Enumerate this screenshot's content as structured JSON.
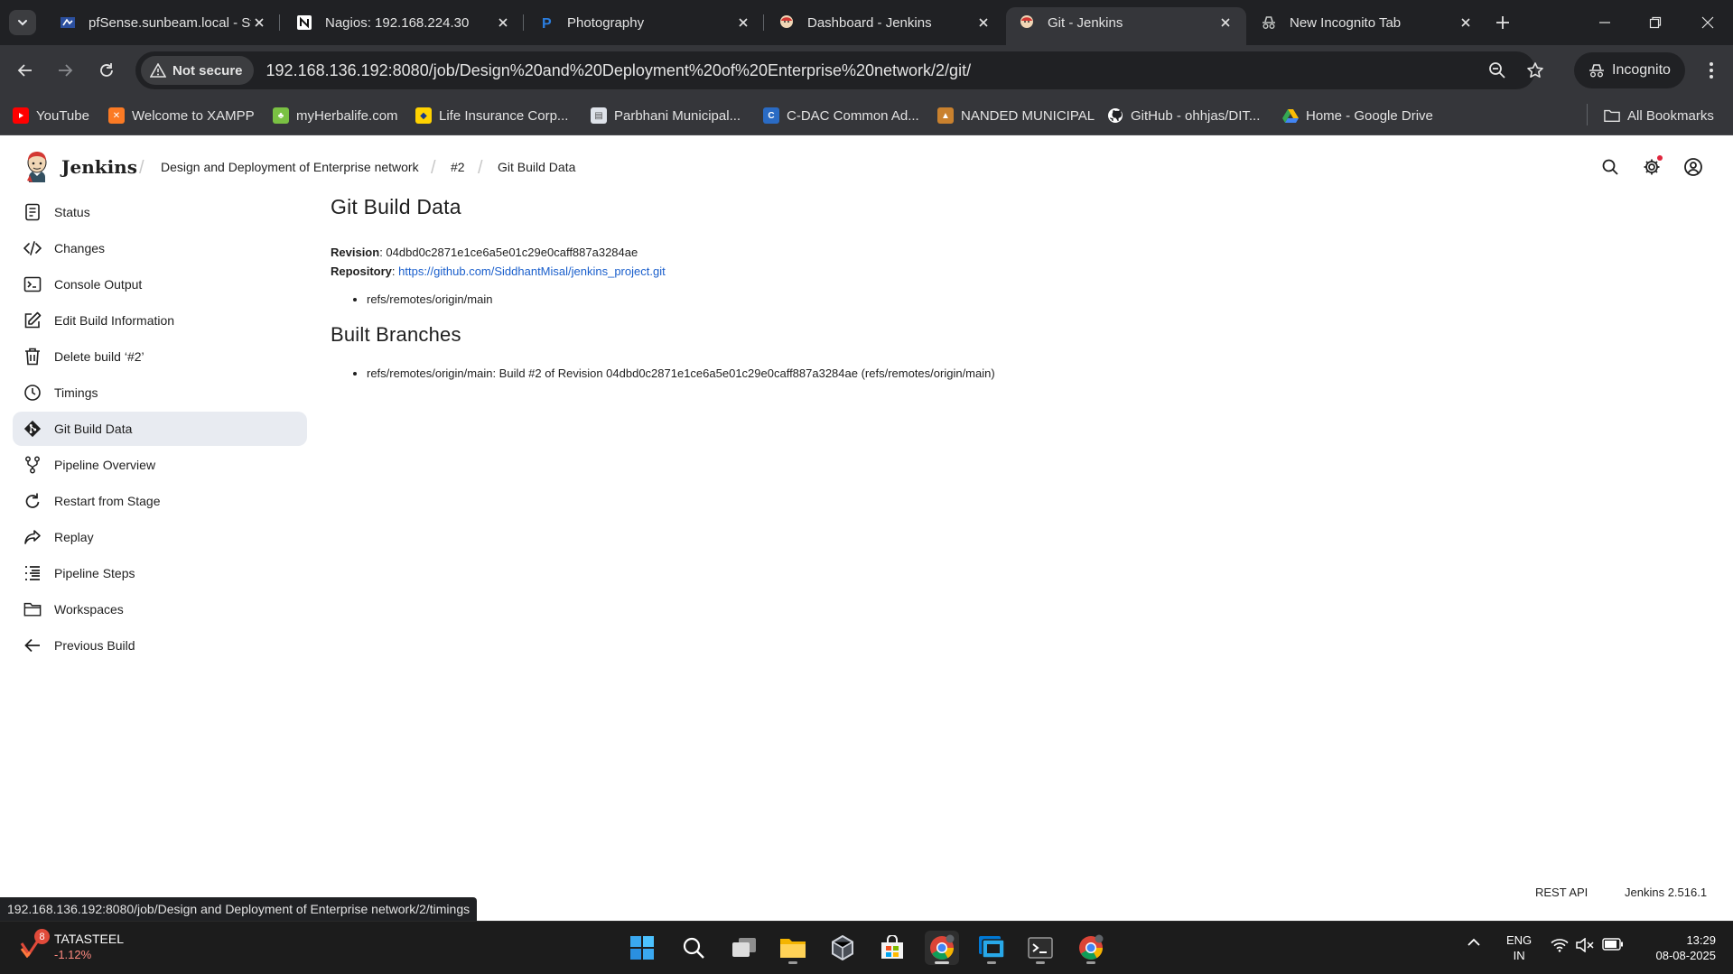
{
  "browser": {
    "tabs": [
      {
        "title": "pfSense.sunbeam.local - Sta",
        "icon": "pfsense-icon"
      },
      {
        "title": "Nagios: 192.168.224.30",
        "icon": "notion-icon"
      },
      {
        "title": "Photography",
        "icon": "pexels-icon"
      },
      {
        "title": "Dashboard - Jenkins",
        "icon": "jenkins-icon"
      },
      {
        "title": "Git - Jenkins",
        "icon": "jenkins-icon",
        "active": true
      },
      {
        "title": "New Incognito Tab",
        "icon": "incognito-icon"
      }
    ],
    "security_chip": "Not secure",
    "url": "192.168.136.192:8080/job/Design%20and%20Deployment%20of%20Enterprise%20network/2/git/",
    "incognito_label": "Incognito",
    "bookmarks": [
      {
        "label": "YouTube",
        "color": "#ff0000"
      },
      {
        "label": "Welcome to XAMPP",
        "color": "#fb7a24"
      },
      {
        "label": "myHerbalife.com",
        "color": "#7ac143"
      },
      {
        "label": "Life Insurance Corp...",
        "color": "#ffd200"
      },
      {
        "label": "Parbhani Municipal...",
        "color": "#dfe3ea"
      },
      {
        "label": "C-DAC Common Ad...",
        "color": "#2a6bc4"
      },
      {
        "label": "NANDED MUNICIPAL",
        "color": "#c9812e"
      },
      {
        "label": "GitHub - ohhjas/DIT...",
        "color": "#ffffff"
      },
      {
        "label": "Home - Google Drive",
        "color": "#34a853"
      }
    ],
    "all_bookmarks": "All Bookmarks",
    "status_url": "192.168.136.192:8080/job/Design and Deployment of Enterprise network/2/timings"
  },
  "jenkins": {
    "brand": "Jenkins",
    "breadcrumbs": [
      "Design and Deployment of Enterprise network",
      "#2",
      "Git Build Data"
    ],
    "sidebar": [
      {
        "label": "Status",
        "icon": "status-icon"
      },
      {
        "label": "Changes",
        "icon": "code-icon"
      },
      {
        "label": "Console Output",
        "icon": "terminal-icon"
      },
      {
        "label": "Edit Build Information",
        "icon": "edit-icon"
      },
      {
        "label": "Delete build ‘#2’",
        "icon": "trash-icon"
      },
      {
        "label": "Timings",
        "icon": "timer-icon"
      },
      {
        "label": "Git Build Data",
        "icon": "git-icon",
        "active": true
      },
      {
        "label": "Pipeline Overview",
        "icon": "pipeline-icon"
      },
      {
        "label": "Restart from Stage",
        "icon": "restart-icon"
      },
      {
        "label": "Replay",
        "icon": "replay-icon"
      },
      {
        "label": "Pipeline Steps",
        "icon": "steps-icon"
      },
      {
        "label": "Workspaces",
        "icon": "folder-icon"
      },
      {
        "label": "Previous Build",
        "icon": "arrow-left-icon"
      }
    ],
    "page_title": "Git Build Data",
    "revision_label": "Revision",
    "revision_value": "04dbd0c2871e1ce6a5e01c29e0caff887a3284ae",
    "repository_label": "Repository",
    "repository_url": "https://github.com/SiddhantMisal/jenkins_project.git",
    "refs": [
      "refs/remotes/origin/main"
    ],
    "built_branches_title": "Built Branches",
    "built_branches": [
      "refs/remotes/origin/main: Build #2 of Revision 04dbd0c2871e1ce6a5e01c29e0caff887a3284ae (refs/remotes/origin/main)"
    ],
    "footer": {
      "rest_api": "REST API",
      "version": "Jenkins 2.516.1"
    }
  },
  "taskbar": {
    "stock_name": "TATASTEEL",
    "stock_change": "-1.12%",
    "stock_badge": "8",
    "lang_1": "ENG",
    "lang_2": "IN",
    "time": "13:29",
    "date": "08-08-2025"
  }
}
